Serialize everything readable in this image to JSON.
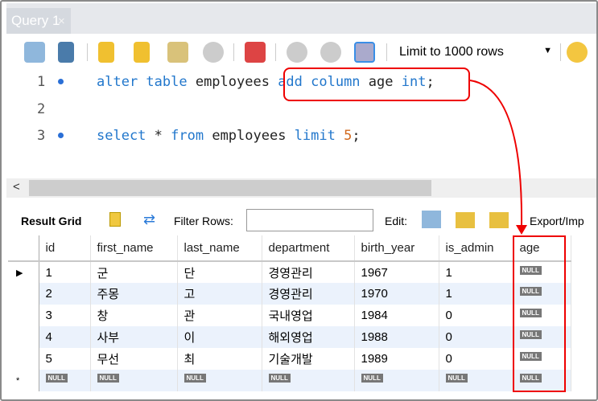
{
  "tab": {
    "title": "Query 1",
    "close": "×"
  },
  "toolbar": {
    "limit": "Limit to 1000 rows"
  },
  "editor": {
    "lines": [
      {
        "n": "1",
        "parts": [
          "alter table",
          " employees ",
          "add column",
          " age ",
          "int",
          ";"
        ]
      },
      {
        "n": "2"
      },
      {
        "n": "3",
        "parts": [
          "select",
          " * ",
          "from",
          " employees ",
          "limit",
          " ",
          "5",
          ";"
        ]
      }
    ]
  },
  "result": {
    "grid_label": "Result Grid",
    "filter_label": "Filter Rows:",
    "filter_value": "",
    "edit_label": "Edit:",
    "export_label": "Export/Imp"
  },
  "grid": {
    "columns": [
      "id",
      "first_name",
      "last_name",
      "department",
      "birth_year",
      "is_admin",
      "age"
    ],
    "rows": [
      [
        "1",
        "군",
        "단",
        "경영관리",
        "1967",
        "1",
        "NULL"
      ],
      [
        "2",
        "주몽",
        "고",
        "경영관리",
        "1970",
        "1",
        "NULL"
      ],
      [
        "3",
        "창",
        "관",
        "국내영업",
        "1984",
        "0",
        "NULL"
      ],
      [
        "4",
        "사부",
        "이",
        "해외영업",
        "1988",
        "0",
        "NULL"
      ],
      [
        "5",
        "무선",
        "최",
        "기술개발",
        "1989",
        "0",
        "NULL"
      ]
    ],
    "new_row": [
      "NULL",
      "NULL",
      "NULL",
      "NULL",
      "NULL",
      "NULL",
      "NULL"
    ]
  }
}
